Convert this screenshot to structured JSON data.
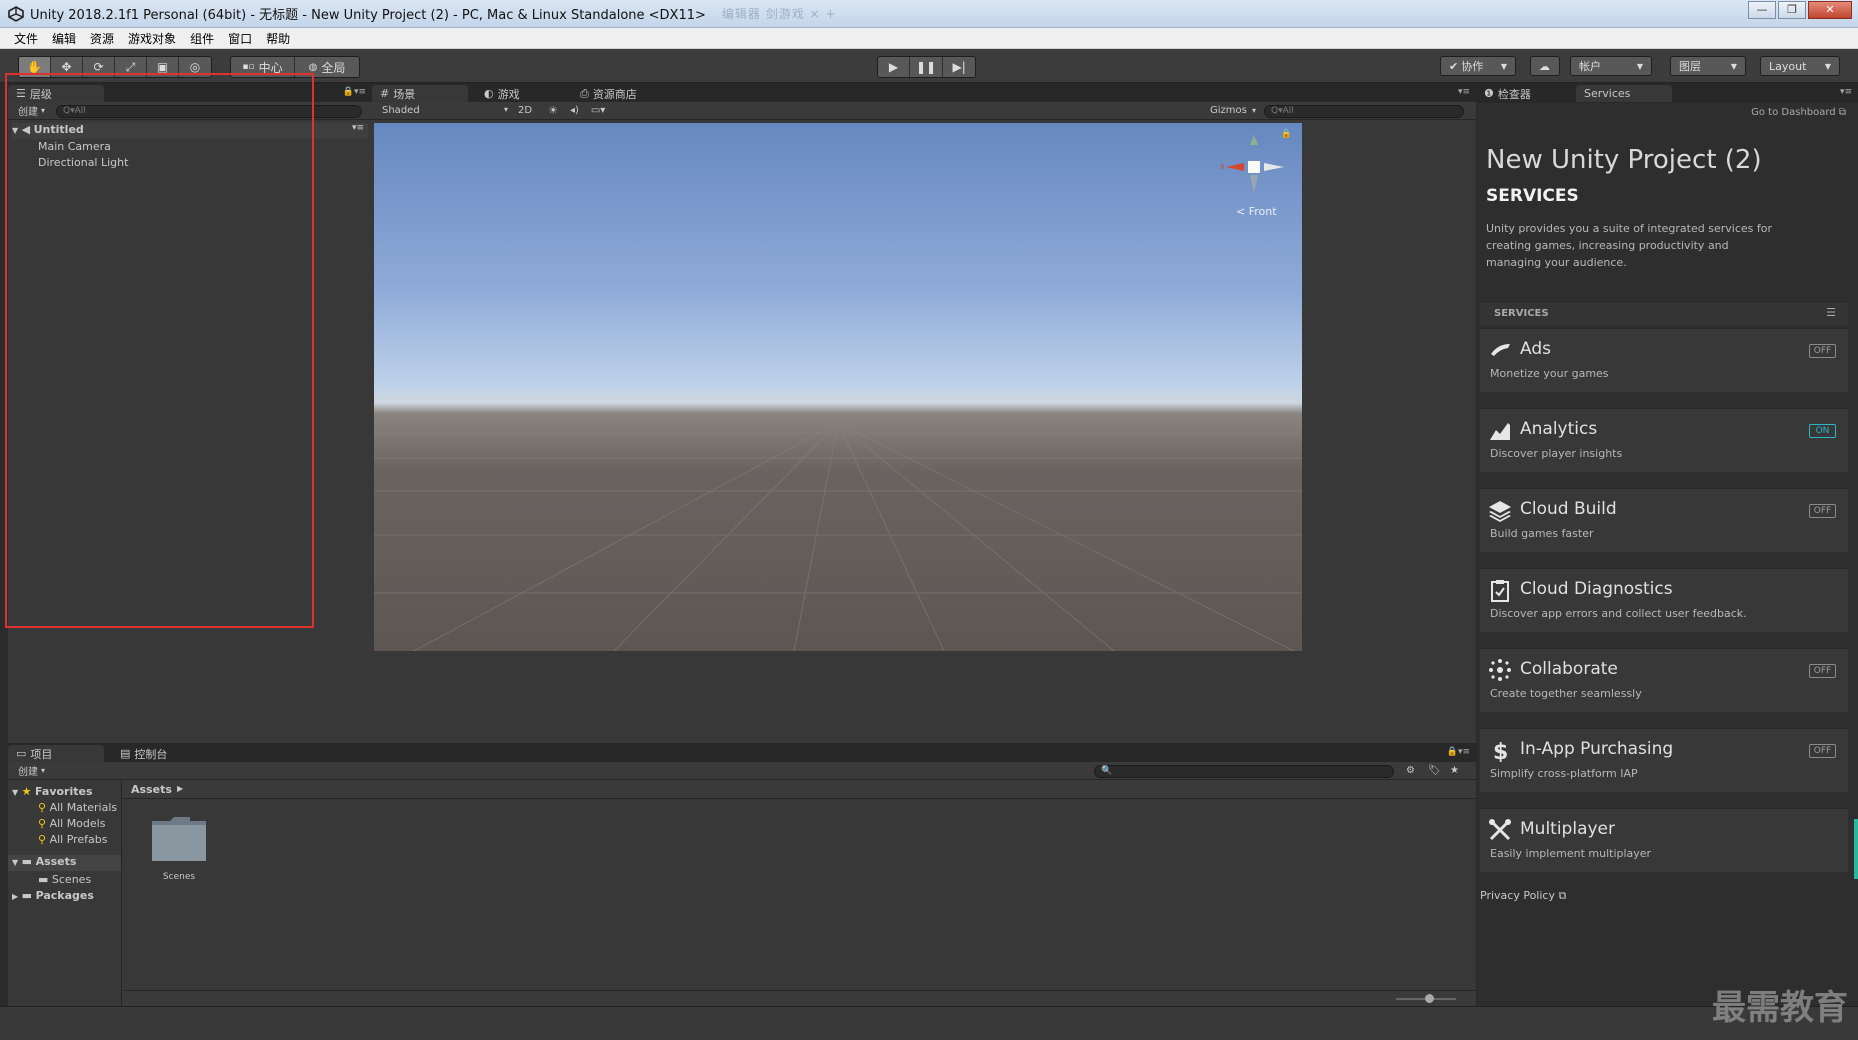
{
  "window": {
    "title": "Unity 2018.2.1f1 Personal (64bit) - 无标题 - New Unity Project (2) - PC, Mac & Linux Standalone <DX11>",
    "blurred_tabs": "编辑器  剑游戏  ×  +"
  },
  "menu": [
    "文件",
    "编辑",
    "资源",
    "游戏对象",
    "组件",
    "窗口",
    "帮助"
  ],
  "toolbar": {
    "pivot": "中心",
    "space": "全局",
    "collab": "协作",
    "account": "帐户",
    "layers": "图层",
    "layout": "Layout"
  },
  "hierarchy": {
    "tab": "层级",
    "create": "创建",
    "search_placeholder": "Q▾All",
    "scene": "Untitled",
    "items": [
      "Main Camera",
      "Directional Light"
    ]
  },
  "scene": {
    "tabs": [
      "场景",
      "游戏",
      "资源商店"
    ],
    "shading": "Shaded",
    "mode_2d": "2D",
    "gizmos": "Gizmos",
    "search_placeholder": "Q▾All",
    "gizmo_label": "Front"
  },
  "project": {
    "tabs": [
      "项目",
      "控制台"
    ],
    "create": "创建",
    "favorites_label": "Favorites",
    "favorites": [
      "All Materials",
      "All Models",
      "All Prefabs"
    ],
    "assets_label": "Assets",
    "assets_children": [
      "Scenes"
    ],
    "packages_label": "Packages",
    "breadcrumb": "Assets",
    "folder_items": [
      "Scenes"
    ]
  },
  "services": {
    "tabs": [
      "检查器",
      "Services"
    ],
    "dashboard": "Go to Dashboard",
    "project_name": "New Unity Project (2)",
    "heading": "SERVICES",
    "intro": "Unity provides you a suite of integrated services for creating games, increasing productivity and managing your audience.",
    "section": "SERVICES",
    "items": [
      {
        "name": "Ads",
        "desc": "Monetize your games",
        "state": "OFF",
        "icon": "megaphone-icon"
      },
      {
        "name": "Analytics",
        "desc": "Discover player insights",
        "state": "ON",
        "icon": "chart-icon"
      },
      {
        "name": "Cloud Build",
        "desc": "Build games faster",
        "state": "OFF",
        "icon": "layers-icon"
      },
      {
        "name": "Cloud Diagnostics",
        "desc": "Discover app errors and collect user feedback.",
        "state": "",
        "icon": "clipboard-check-icon"
      },
      {
        "name": "Collaborate",
        "desc": "Create together seamlessly",
        "state": "OFF",
        "icon": "collaborate-icon"
      },
      {
        "name": "In-App Purchasing",
        "desc": "Simplify cross-platform IAP",
        "state": "OFF",
        "icon": "dollar-icon"
      },
      {
        "name": "Multiplayer",
        "desc": "Easily implement multiplayer",
        "state": "",
        "icon": "multiplayer-icon"
      }
    ],
    "privacy": "Privacy Policy"
  },
  "watermark": "最需教育",
  "colors": {
    "highlight": "#e03131",
    "on": "#2ab7c9",
    "bg": "#383838"
  }
}
